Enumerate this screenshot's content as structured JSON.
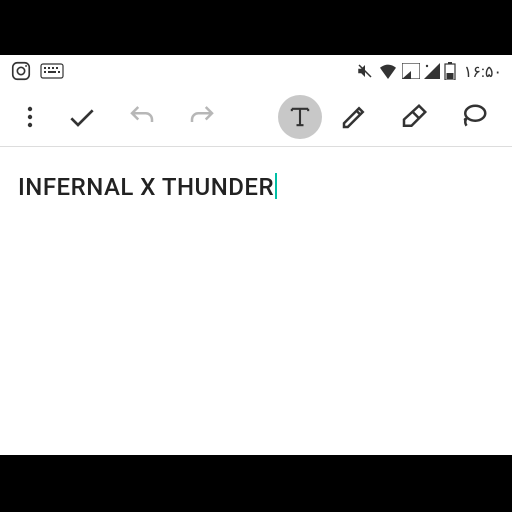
{
  "status": {
    "time": "۱۶:۵۰"
  },
  "note": {
    "content": "INFERNAL X THUNDER"
  }
}
